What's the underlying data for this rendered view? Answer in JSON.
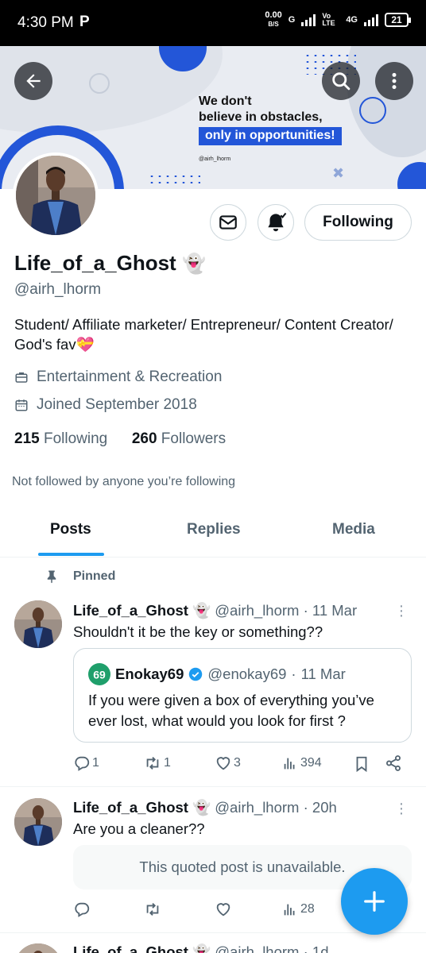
{
  "status_bar": {
    "time": "4:30 PM",
    "app_glyph": "P",
    "net_speed": "0.00",
    "net_unit": "B/S",
    "network_g": "G",
    "volte": "Vo LTE",
    "network_4g": "4G",
    "battery": "21"
  },
  "banner": {
    "quote_line1": "We don't",
    "quote_line2": "believe in obstacles,",
    "quote_highlight": "only in opportunities!",
    "quote_handle": "@airh_lhorm"
  },
  "profile": {
    "name": "Life_of_a_Ghost",
    "name_emoji": "👻",
    "handle": "@airh_lhorm",
    "bio": "Student/ Affiliate marketer/ Entrepreneur/ Content Creator/ God's fav💝",
    "category": "Entertainment & Recreation",
    "joined": "Joined September 2018",
    "following_count": "215",
    "following_label": "Following",
    "followers_count": "260",
    "followers_label": "Followers",
    "not_followed": "Not followed by anyone you’re following",
    "following_button": "Following"
  },
  "tabs": [
    {
      "label": "Posts",
      "active": true
    },
    {
      "label": "Replies",
      "active": false
    },
    {
      "label": "Media",
      "active": false
    }
  ],
  "posts": [
    {
      "pinned_label": "Pinned",
      "author": "Life_of_a_Ghost",
      "emoji": "👻",
      "handle": "@airh_lhorm",
      "time": "11 Mar",
      "text": "Shouldn't it be the key or something??",
      "quote": {
        "author": "Enokay69",
        "handle": "@enokay69",
        "time": "11 Mar",
        "text": "If you were given a box of everything you’ve ever lost, what would you look for first ?"
      },
      "replies": "1",
      "reposts": "1",
      "likes": "3",
      "views": "394"
    },
    {
      "author": "Life_of_a_Ghost",
      "emoji": "👻",
      "handle": "@airh_lhorm",
      "time": "20h",
      "text": "Are you a cleaner??",
      "unavailable": "This quoted post is unavailable.",
      "views": "28"
    },
    {
      "author": "Life_of_a_Ghost",
      "emoji": "👻",
      "handle": "@airh_lhorm",
      "time": "1d"
    }
  ],
  "colors": {
    "accent": "#1d9bf0",
    "banner_blue": "#2356d8",
    "text_primary": "#0f1419",
    "text_secondary": "#536471"
  }
}
